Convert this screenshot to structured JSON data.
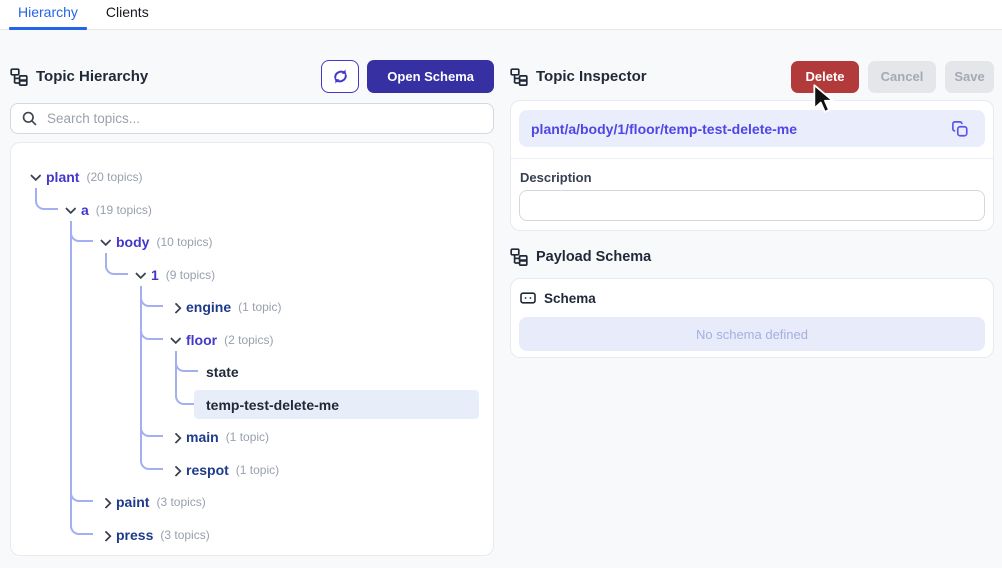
{
  "tabs": {
    "hierarchy": "Hierarchy",
    "clients": "Clients"
  },
  "left": {
    "title": "Topic Hierarchy",
    "refresh_icon": "refresh-icon",
    "open_schema_label": "Open Schema",
    "search_placeholder": "Search topics...",
    "search_icon": "search-icon",
    "tree": [
      {
        "label": "plant",
        "count": "(20 topics)",
        "level": 0,
        "state": "expanded"
      },
      {
        "label": "a",
        "count": "(19 topics)",
        "level": 1,
        "state": "expanded"
      },
      {
        "label": "body",
        "count": "(10 topics)",
        "level": 2,
        "state": "expanded"
      },
      {
        "label": "1",
        "count": "(9 topics)",
        "level": 3,
        "state": "expanded"
      },
      {
        "label": "engine",
        "count": "(1 topic)",
        "level": 4,
        "state": "collapsed"
      },
      {
        "label": "floor",
        "count": "(2 topics)",
        "level": 4,
        "state": "expanded"
      },
      {
        "label": "state",
        "count": "",
        "level": 5,
        "state": "leaf"
      },
      {
        "label": "temp-test-delete-me",
        "count": "",
        "level": 5,
        "state": "leaf",
        "selected": true
      },
      {
        "label": "main",
        "count": "(1 topic)",
        "level": 4,
        "state": "collapsed"
      },
      {
        "label": "respot",
        "count": "(1 topic)",
        "level": 4,
        "state": "collapsed"
      },
      {
        "label": "paint",
        "count": "(3 topics)",
        "level": 2,
        "state": "collapsed"
      },
      {
        "label": "press",
        "count": "(3 topics)",
        "level": 2,
        "state": "collapsed"
      }
    ]
  },
  "inspector": {
    "title": "Topic Inspector",
    "delete_label": "Delete",
    "cancel_label": "Cancel",
    "save_label": "Save",
    "topic_path": "plant/a/body/1/floor/temp-test-delete-me",
    "copy_icon": "copy-icon",
    "description_label": "Description",
    "description_value": ""
  },
  "payload_schema": {
    "title": "Payload Schema",
    "schema_label": "Schema",
    "schema_icon": "schema-box-icon",
    "empty_text": "No schema defined"
  },
  "colors": {
    "tab_active": "#2563eb",
    "primary_button": "#3730a3",
    "refresh_border": "#4338ca",
    "delete_button": "#b33a3a",
    "disabled_button_bg": "#e4e6ea",
    "tree_expanded": "#4338ca",
    "tree_collapsed": "#1e3a8a",
    "tree_leaf": "#1f2937",
    "connector": "#a2aff2",
    "selected_row_bg": "#e8eef9",
    "path_box_bg": "#e9edfc",
    "path_text": "#4f46e5",
    "no_schema_bg": "#e7ebfa",
    "no_schema_text": "#a5b0e0"
  }
}
